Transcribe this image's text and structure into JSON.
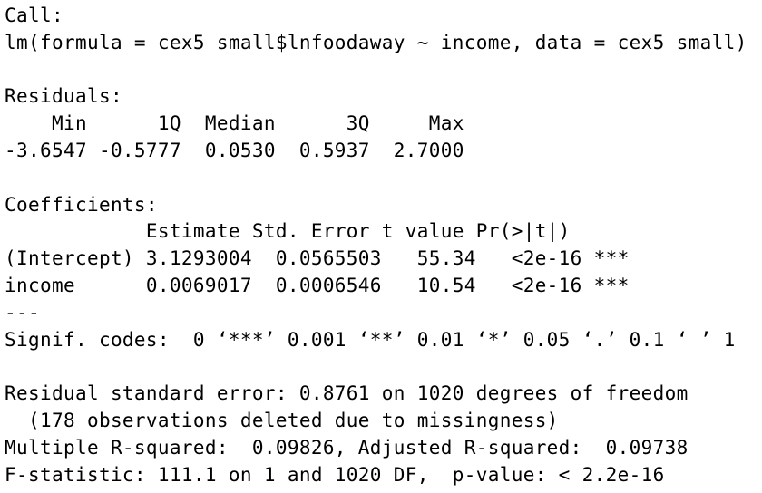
{
  "output": {
    "call_header": "Call:",
    "call_formula": "lm(formula = cex5_small$lnfoodaway ~ income, data = cex5_small)",
    "residuals_header": "Residuals:",
    "residuals_labels": "    Min      1Q  Median      3Q     Max ",
    "residuals_values": "-3.6547 -0.5777  0.0530  0.5937  2.7000 ",
    "coefficients_header": "Coefficients:",
    "coefficients_columns": "            Estimate Std. Error t value Pr(>|t|)    ",
    "coefficients_rows": [
      "(Intercept) 3.1293004  0.0565503   55.34   <2e-16 ***",
      "income      0.0069017  0.0006546   10.54   <2e-16 ***"
    ],
    "separator": "---",
    "signif_codes": "Signif. codes:  0 ‘***’ 0.001 ‘**’ 0.01 ‘*’ 0.05 ‘.’ 0.1 ‘ ’ 1",
    "residual_se": "Residual standard error: 0.8761 on 1020 degrees of freedom",
    "missingness": "  (178 observations deleted due to missingness)",
    "r_squared": "Multiple R-squared:  0.09826, Adjusted R-squared:  0.09738 ",
    "f_statistic": "F-statistic: 111.1 on 1 and 1020 DF,  p-value: < 2.2e-16"
  }
}
